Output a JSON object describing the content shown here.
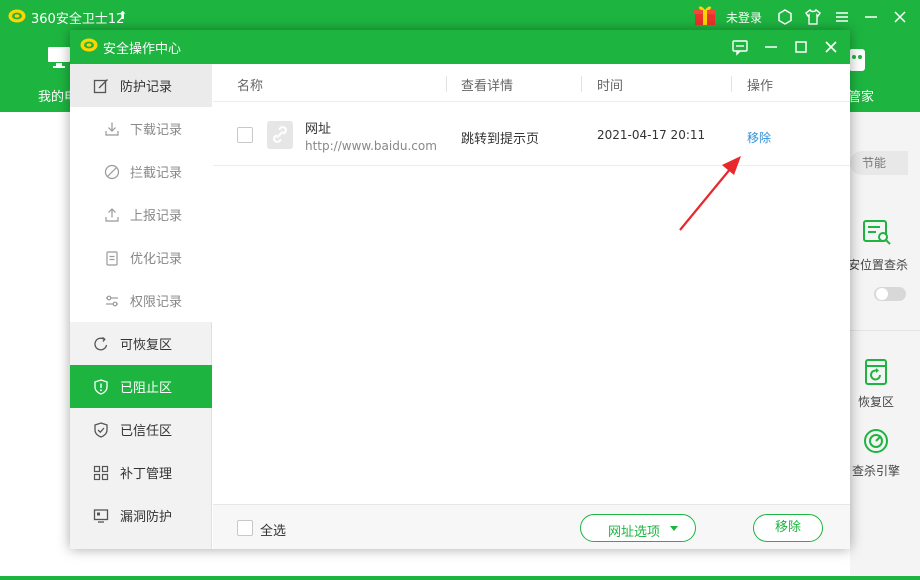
{
  "app": {
    "title": "360安全卫士12",
    "login": "未登录",
    "nav_left": "我的电",
    "nav_right": "管家",
    "right_panel": {
      "save_label": "节能",
      "scan_label": "安位置查杀",
      "restore_label": "恢复区",
      "engine_label": "查杀引擎"
    }
  },
  "dialog": {
    "title": "安全操作中心",
    "sidebar": {
      "items": [
        {
          "label": "防护记录",
          "icon": "edit-icon"
        },
        {
          "label": "下载记录",
          "icon": "download-icon"
        },
        {
          "label": "拦截记录",
          "icon": "block-icon"
        },
        {
          "label": "上报记录",
          "icon": "upload-icon"
        },
        {
          "label": "优化记录",
          "icon": "clipboard-icon"
        },
        {
          "label": "权限记录",
          "icon": "sliders-icon"
        },
        {
          "label": "可恢复区",
          "icon": "refresh-icon"
        },
        {
          "label": "已阻止区",
          "icon": "shield-alert-icon"
        },
        {
          "label": "已信任区",
          "icon": "shield-check-icon"
        },
        {
          "label": "补丁管理",
          "icon": "grid-icon"
        },
        {
          "label": "漏洞防护",
          "icon": "monitor-icon"
        }
      ],
      "active": "已阻止区"
    },
    "table": {
      "columns": [
        "名称",
        "查看详情",
        "时间",
        "操作"
      ],
      "rows": [
        {
          "name": "网址",
          "url": "http://www.baidu.com",
          "detail": "跳转到提示页",
          "time": "2021-04-17 20:11",
          "action": "移除"
        }
      ]
    },
    "footer": {
      "select_all": "全选",
      "url_options": "网址选项",
      "remove": "移除"
    }
  },
  "colors": {
    "brand_green": "#1db540",
    "link_blue": "#2e8fd8",
    "annotation_red": "#e8282b"
  }
}
